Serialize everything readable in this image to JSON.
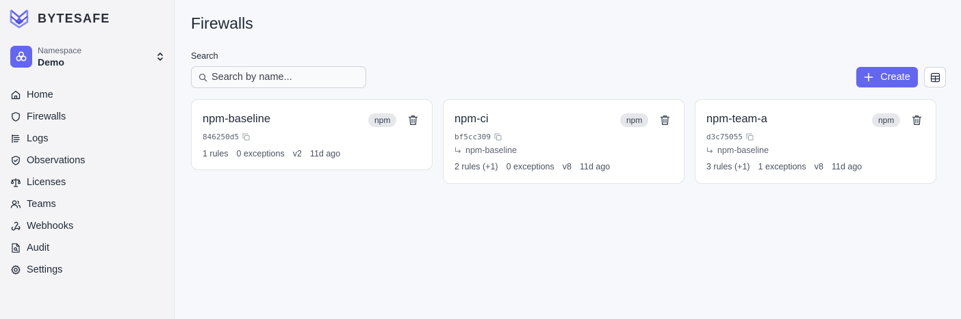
{
  "brand": {
    "name": "BYTESAFE"
  },
  "namespace": {
    "label": "Namespace",
    "value": "Demo"
  },
  "nav": [
    {
      "label": "Home",
      "icon": "home-icon"
    },
    {
      "label": "Firewalls",
      "icon": "shield-icon"
    },
    {
      "label": "Logs",
      "icon": "logs-icon"
    },
    {
      "label": "Observations",
      "icon": "shield-check-icon"
    },
    {
      "label": "Licenses",
      "icon": "scale-icon"
    },
    {
      "label": "Teams",
      "icon": "users-icon"
    },
    {
      "label": "Webhooks",
      "icon": "webhook-icon"
    },
    {
      "label": "Audit",
      "icon": "file-search-icon"
    },
    {
      "label": "Settings",
      "icon": "gear-icon"
    }
  ],
  "page": {
    "title": "Firewalls"
  },
  "search": {
    "label": "Search",
    "placeholder": "Search by name..."
  },
  "toolbar": {
    "create_label": "Create"
  },
  "colors": {
    "accent": "#6366f1",
    "badge_bg": "#e5e7eb"
  },
  "firewalls": [
    {
      "name": "npm-baseline",
      "badge": "npm",
      "id": "846250d5",
      "parent": "",
      "rules": "1 rules",
      "exceptions": "0 exceptions",
      "version": "v2",
      "age": "11d ago"
    },
    {
      "name": "npm-ci",
      "badge": "npm",
      "id": "bf5cc309",
      "parent": "npm-baseline",
      "rules": "2 rules (+1)",
      "exceptions": "0 exceptions",
      "version": "v8",
      "age": "11d ago"
    },
    {
      "name": "npm-team-a",
      "badge": "npm",
      "id": "d3c75055",
      "parent": "npm-baseline",
      "rules": "3 rules (+1)",
      "exceptions": "1 exceptions",
      "version": "v8",
      "age": "11d ago"
    }
  ]
}
